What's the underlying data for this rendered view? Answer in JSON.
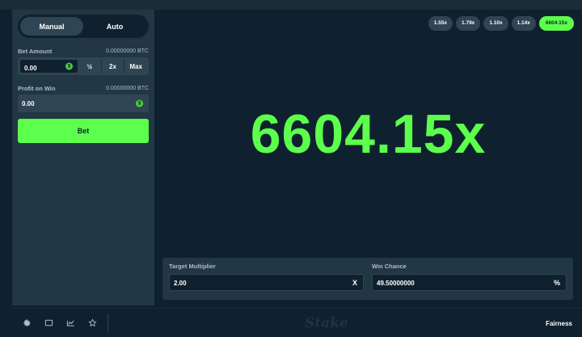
{
  "mode_tabs": {
    "manual": "Manual",
    "auto": "Auto"
  },
  "bet_amount": {
    "label": "Bet Amount",
    "amount_display": "0.00000000 BTC",
    "value": "0.00",
    "currency_symbol": "$",
    "half_label": "½",
    "double_label": "2x",
    "max_label": "Max"
  },
  "profit_on_win": {
    "label": "Profit on Win",
    "amount_display": "0.00000000 BTC",
    "value": "0.00",
    "currency_symbol": "$"
  },
  "bet_button_label": "Bet",
  "history": [
    "1.55x",
    "1.79x",
    "1.10x",
    "1.14x",
    "6604.15x"
  ],
  "result_multiplier": "6604.15x",
  "target_multiplier": {
    "label": "Target Multiplier",
    "value": "2.00",
    "suffix": "X"
  },
  "win_chance": {
    "label": "Win Chance",
    "value": "49.50000000",
    "suffix": "%"
  },
  "footer": {
    "logo": "Stake",
    "fairness": "Fairness"
  },
  "colors": {
    "accent": "#5cff4c",
    "panel": "#213743",
    "background": "#0f212e"
  },
  "icons": [
    "settings-icon",
    "theatre-mode-icon",
    "stats-icon",
    "favorite-star-icon"
  ]
}
